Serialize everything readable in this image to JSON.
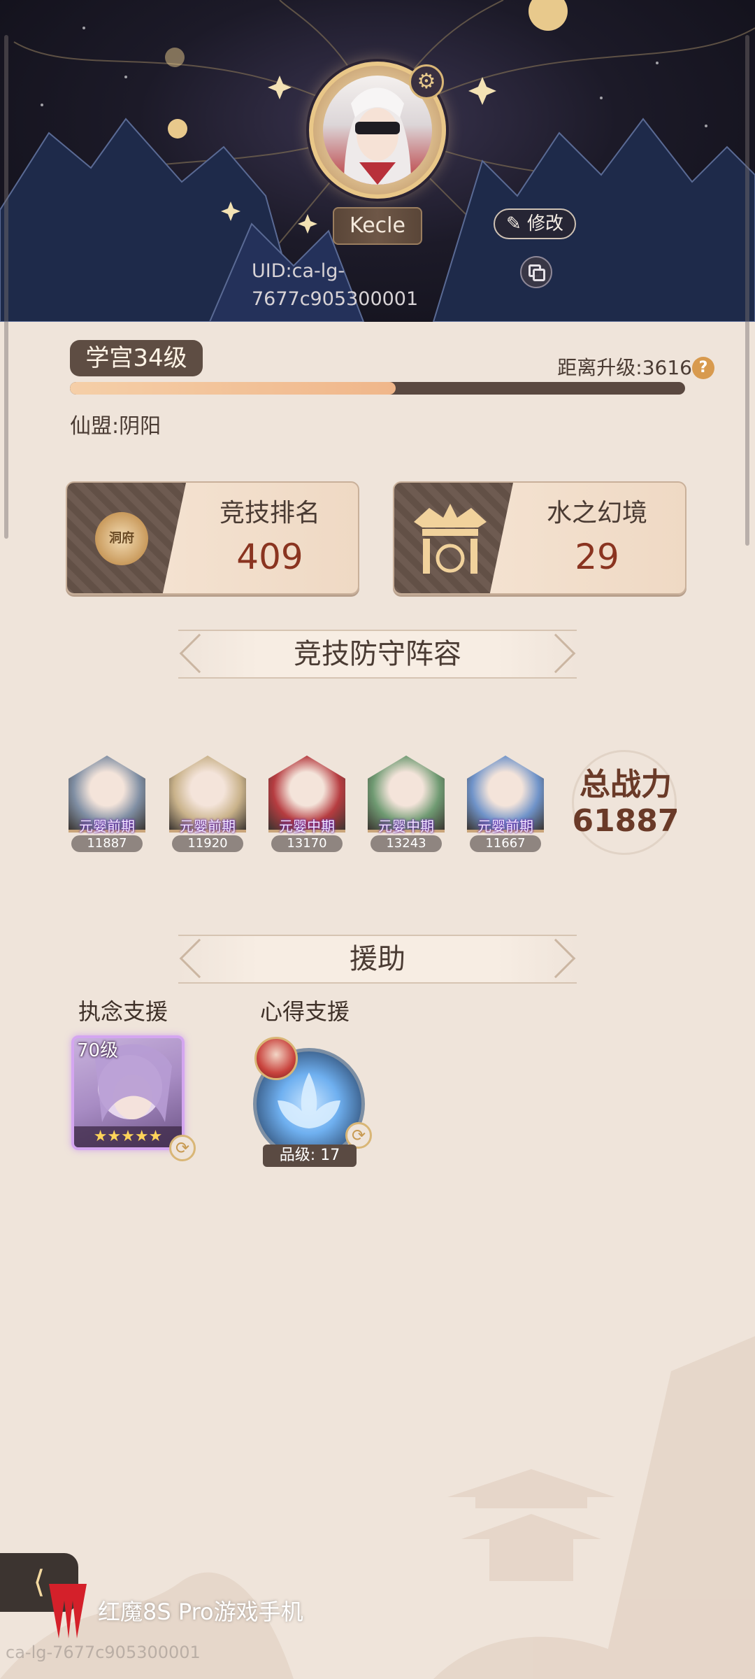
{
  "profile": {
    "name": "Kecle",
    "edit_label": "修改",
    "uid": "UID:ca-lg-7677c905300001"
  },
  "level": {
    "badge": "学宫34级",
    "remaining": "距离升级:3616",
    "progress_fraction": 0.53
  },
  "guild": "仙盟:阴阳",
  "stats": [
    {
      "label": "竞技排名",
      "value": "409",
      "emblem_text": "洞府"
    },
    {
      "label": "水之幻境",
      "value": "29"
    }
  ],
  "defense": {
    "title": "竞技防守阵容",
    "heroes": [
      {
        "rank": "元婴前期",
        "power": "11887",
        "color": "#7f8ea3"
      },
      {
        "rank": "元婴前期",
        "power": "11920",
        "color": "#c9b28a"
      },
      {
        "rank": "元婴中期",
        "power": "13170",
        "color": "#b63c40"
      },
      {
        "rank": "元婴中期",
        "power": "13243",
        "color": "#6f9a72"
      },
      {
        "rank": "元婴前期",
        "power": "11667",
        "color": "#6f93c9"
      }
    ],
    "total_label": "总战力",
    "total_value": "61887"
  },
  "assist": {
    "title": "援助",
    "support1_label": "执念支援",
    "support1_level": "70级",
    "support1_stars": "★★★★★",
    "support2_label": "心得支援",
    "support2_grade": "品级: 17"
  },
  "footer": {
    "brand": "红魔8S Pro游戏手机",
    "watermark": "ca-lg-7677c905300001"
  },
  "colors": {
    "accent_gold": "#d9b676",
    "stat_value": "#8a3420",
    "progress_fill": "#f5cfa8"
  },
  "icons": [
    "gear-icon",
    "pencil-icon",
    "copy-icon",
    "help-icon",
    "swap-icon",
    "red-magic-logo"
  ]
}
